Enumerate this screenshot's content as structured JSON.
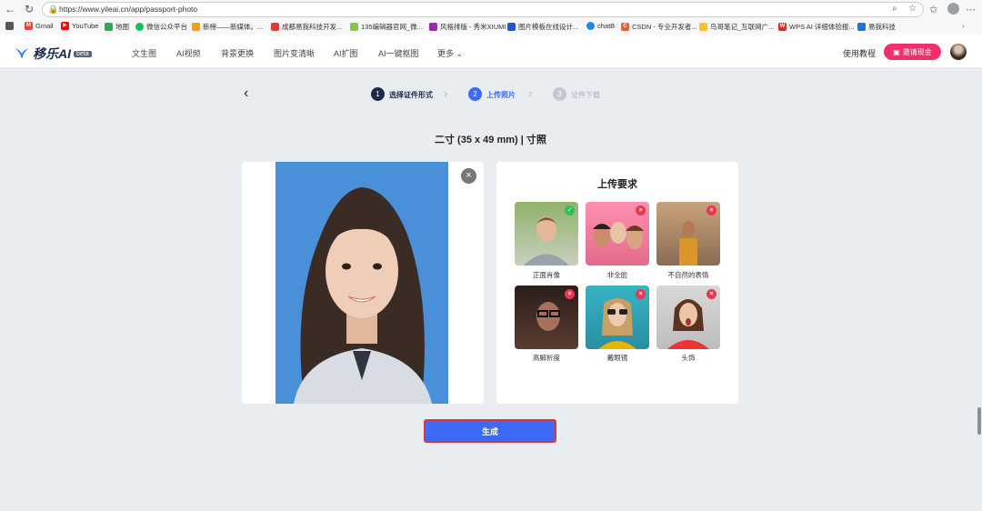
{
  "browser": {
    "url": "https://www.yileai.cn/app/passport-photo",
    "bookmarks": [
      "Gmail",
      "YouTube",
      "地图",
      "微信公众平台",
      "新榜——新媒体。...",
      "成都易我科技开发...",
      "135编辑器官网_微...",
      "风格排版 - 秀米XIUMI",
      "图片模板在线设计...",
      "chatB",
      "CSDN - 专业开发者...",
      "鸟哥笔记_互联网广...",
      "WPS AI 详细体验报...",
      "易我科技"
    ]
  },
  "header": {
    "logo": "移乐AI",
    "beta": "beta",
    "nav": [
      "文生图",
      "AI视频",
      "背景更换",
      "图片变清晰",
      "AI扩图",
      "AI一键抠图",
      "更多"
    ],
    "tutorial": "使用教程",
    "invite": "邀请现金"
  },
  "steps": [
    {
      "num": "1",
      "label": "选择证件形式"
    },
    {
      "num": "2",
      "label": "上传照片"
    },
    {
      "num": "3",
      "label": "证件下载"
    }
  ],
  "title": "二寸 (35 x 49 mm)  |  寸照",
  "requirements": {
    "title": "上传要求",
    "items": [
      {
        "label": "正面肖像",
        "ok": true
      },
      {
        "label": "非全脸",
        "ok": false
      },
      {
        "label": "不自然的表情",
        "ok": false
      },
      {
        "label": "高解析度",
        "ok": false
      },
      {
        "label": "戴眼镜",
        "ok": false
      },
      {
        "label": "头饰",
        "ok": false
      }
    ]
  },
  "generate": "生成",
  "colors": {
    "accent": "#3d6af2",
    "invite": "#f0306a",
    "ok": "#2fbf5a",
    "bad": "#e8384f"
  }
}
